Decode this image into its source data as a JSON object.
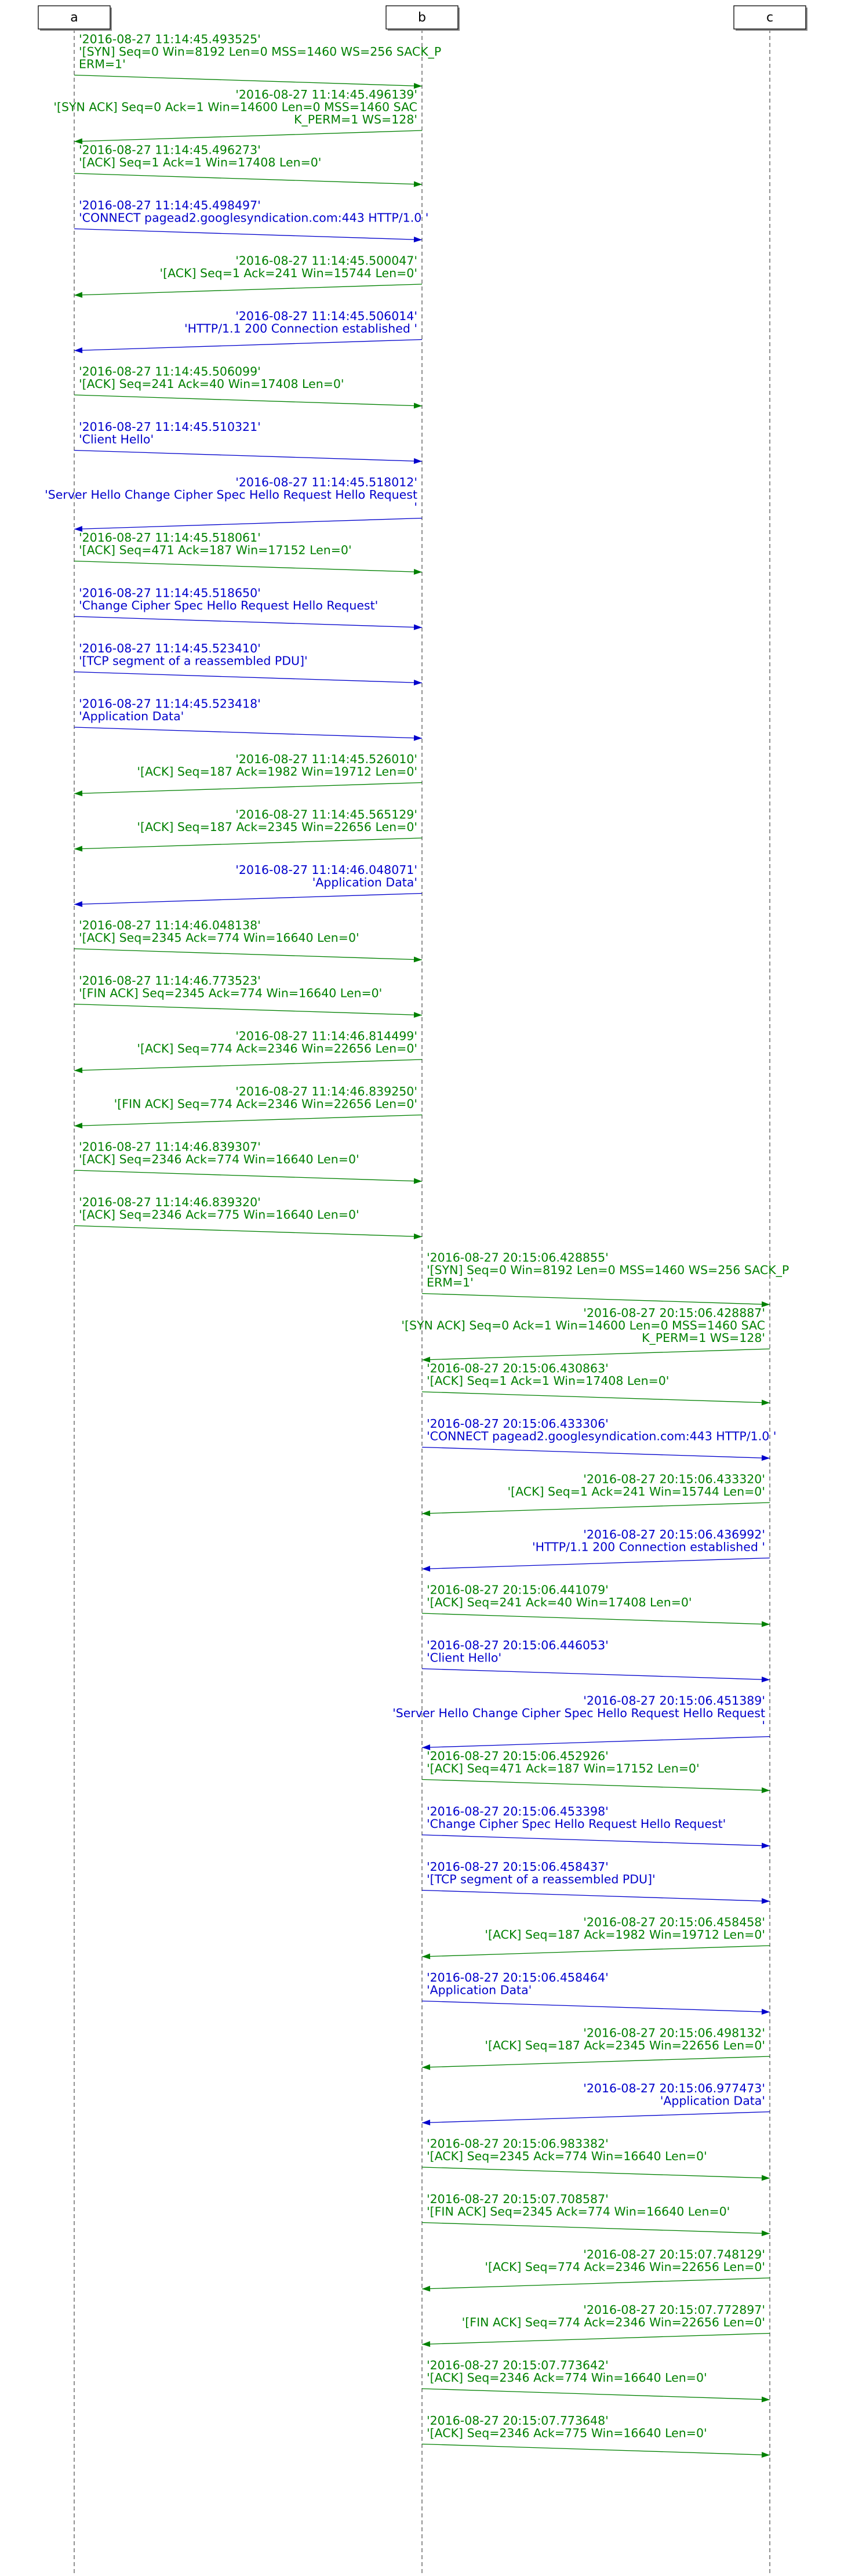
{
  "colors": {
    "green": "#008000",
    "blue": "#0000cc",
    "line": "#555555"
  },
  "participants": [
    {
      "id": "a",
      "label": "a"
    },
    {
      "id": "b",
      "label": "b"
    },
    {
      "id": "c",
      "label": "c"
    }
  ],
  "messages": [
    {
      "from": "a",
      "to": "b",
      "color": "green",
      "lines": [
        "'2016-08-27 11:14:45.493525'",
        "'[SYN] Seq=0 Win=8192 Len=0 MSS=1460 WS=256 SACK_P",
        "ERM=1'"
      ]
    },
    {
      "from": "b",
      "to": "a",
      "color": "green",
      "lines": [
        "'2016-08-27 11:14:45.496139'",
        "'[SYN ACK] Seq=0 Ack=1 Win=14600 Len=0 MSS=1460 SAC",
        "K_PERM=1 WS=128'"
      ]
    },
    {
      "from": "a",
      "to": "b",
      "color": "green",
      "lines": [
        "'2016-08-27 11:14:45.496273'",
        "'[ACK] Seq=1 Ack=1 Win=17408 Len=0'"
      ]
    },
    {
      "from": "a",
      "to": "b",
      "color": "blue",
      "lines": [
        "'2016-08-27 11:14:45.498497'",
        "'CONNECT pagead2.googlesyndication.com:443 HTTP/1.0 '"
      ]
    },
    {
      "from": "b",
      "to": "a",
      "color": "green",
      "lines": [
        "'2016-08-27 11:14:45.500047'",
        "'[ACK] Seq=1 Ack=241 Win=15744 Len=0'"
      ]
    },
    {
      "from": "b",
      "to": "a",
      "color": "blue",
      "lines": [
        "'2016-08-27 11:14:45.506014'",
        "'HTTP/1.1 200 Connection established '"
      ]
    },
    {
      "from": "a",
      "to": "b",
      "color": "green",
      "lines": [
        "'2016-08-27 11:14:45.506099'",
        "'[ACK] Seq=241 Ack=40 Win=17408 Len=0'"
      ]
    },
    {
      "from": "a",
      "to": "b",
      "color": "blue",
      "lines": [
        "'2016-08-27 11:14:45.510321'",
        "'Client Hello'"
      ]
    },
    {
      "from": "b",
      "to": "a",
      "color": "blue",
      "lines": [
        "'2016-08-27 11:14:45.518012'",
        "'Server Hello Change Cipher Spec Hello Request Hello Request",
        "'"
      ]
    },
    {
      "from": "a",
      "to": "b",
      "color": "green",
      "lines": [
        "'2016-08-27 11:14:45.518061'",
        "'[ACK] Seq=471 Ack=187 Win=17152 Len=0'"
      ]
    },
    {
      "from": "a",
      "to": "b",
      "color": "blue",
      "lines": [
        "'2016-08-27 11:14:45.518650'",
        "'Change Cipher Spec Hello Request Hello Request'"
      ]
    },
    {
      "from": "a",
      "to": "b",
      "color": "blue",
      "lines": [
        "'2016-08-27 11:14:45.523410'",
        "'[TCP segment of a reassembled PDU]'"
      ]
    },
    {
      "from": "a",
      "to": "b",
      "color": "blue",
      "lines": [
        "'2016-08-27 11:14:45.523418'",
        "'Application Data'"
      ]
    },
    {
      "from": "b",
      "to": "a",
      "color": "green",
      "lines": [
        "'2016-08-27 11:14:45.526010'",
        "'[ACK] Seq=187 Ack=1982 Win=19712 Len=0'"
      ]
    },
    {
      "from": "b",
      "to": "a",
      "color": "green",
      "lines": [
        "'2016-08-27 11:14:45.565129'",
        "'[ACK] Seq=187 Ack=2345 Win=22656 Len=0'"
      ]
    },
    {
      "from": "b",
      "to": "a",
      "color": "blue",
      "lines": [
        "'2016-08-27 11:14:46.048071'",
        "'Application Data'"
      ]
    },
    {
      "from": "a",
      "to": "b",
      "color": "green",
      "lines": [
        "'2016-08-27 11:14:46.048138'",
        "'[ACK] Seq=2345 Ack=774 Win=16640 Len=0'"
      ]
    },
    {
      "from": "a",
      "to": "b",
      "color": "green",
      "lines": [
        "'2016-08-27 11:14:46.773523'",
        "'[FIN ACK] Seq=2345 Ack=774 Win=16640 Len=0'"
      ]
    },
    {
      "from": "b",
      "to": "a",
      "color": "green",
      "lines": [
        "'2016-08-27 11:14:46.814499'",
        "'[ACK] Seq=774 Ack=2346 Win=22656 Len=0'"
      ]
    },
    {
      "from": "b",
      "to": "a",
      "color": "green",
      "lines": [
        "'2016-08-27 11:14:46.839250'",
        "'[FIN ACK] Seq=774 Ack=2346 Win=22656 Len=0'"
      ]
    },
    {
      "from": "a",
      "to": "b",
      "color": "green",
      "lines": [
        "'2016-08-27 11:14:46.839307'",
        "'[ACK] Seq=2346 Ack=774 Win=16640 Len=0'"
      ]
    },
    {
      "from": "a",
      "to": "b",
      "color": "green",
      "lines": [
        "'2016-08-27 11:14:46.839320'",
        "'[ACK] Seq=2346 Ack=775 Win=16640 Len=0'"
      ]
    },
    {
      "from": "b",
      "to": "c",
      "color": "green",
      "lines": [
        "'2016-08-27 20:15:06.428855'",
        "'[SYN] Seq=0 Win=8192 Len=0 MSS=1460 WS=256 SACK_P",
        "ERM=1'"
      ]
    },
    {
      "from": "c",
      "to": "b",
      "color": "green",
      "lines": [
        "'2016-08-27 20:15:06.428887'",
        "'[SYN ACK] Seq=0 Ack=1 Win=14600 Len=0 MSS=1460 SAC",
        "K_PERM=1 WS=128'"
      ]
    },
    {
      "from": "b",
      "to": "c",
      "color": "green",
      "lines": [
        "'2016-08-27 20:15:06.430863'",
        "'[ACK] Seq=1 Ack=1 Win=17408 Len=0'"
      ]
    },
    {
      "from": "b",
      "to": "c",
      "color": "blue",
      "lines": [
        "'2016-08-27 20:15:06.433306'",
        "'CONNECT pagead2.googlesyndication.com:443 HTTP/1.0 '"
      ]
    },
    {
      "from": "c",
      "to": "b",
      "color": "green",
      "lines": [
        "'2016-08-27 20:15:06.433320'",
        "'[ACK] Seq=1 Ack=241 Win=15744 Len=0'"
      ]
    },
    {
      "from": "c",
      "to": "b",
      "color": "blue",
      "lines": [
        "'2016-08-27 20:15:06.436992'",
        "'HTTP/1.1 200 Connection established '"
      ]
    },
    {
      "from": "b",
      "to": "c",
      "color": "green",
      "lines": [
        "'2016-08-27 20:15:06.441079'",
        "'[ACK] Seq=241 Ack=40 Win=17408 Len=0'"
      ]
    },
    {
      "from": "b",
      "to": "c",
      "color": "blue",
      "lines": [
        "'2016-08-27 20:15:06.446053'",
        "'Client Hello'"
      ]
    },
    {
      "from": "c",
      "to": "b",
      "color": "blue",
      "lines": [
        "'2016-08-27 20:15:06.451389'",
        "'Server Hello Change Cipher Spec Hello Request Hello Request",
        "'"
      ]
    },
    {
      "from": "b",
      "to": "c",
      "color": "green",
      "lines": [
        "'2016-08-27 20:15:06.452926'",
        "'[ACK] Seq=471 Ack=187 Win=17152 Len=0'"
      ]
    },
    {
      "from": "b",
      "to": "c",
      "color": "blue",
      "lines": [
        "'2016-08-27 20:15:06.453398'",
        "'Change Cipher Spec Hello Request Hello Request'"
      ]
    },
    {
      "from": "b",
      "to": "c",
      "color": "blue",
      "lines": [
        "'2016-08-27 20:15:06.458437'",
        "'[TCP segment of a reassembled PDU]'"
      ]
    },
    {
      "from": "c",
      "to": "b",
      "color": "green",
      "lines": [
        "'2016-08-27 20:15:06.458458'",
        "'[ACK] Seq=187 Ack=1982 Win=19712 Len=0'"
      ]
    },
    {
      "from": "b",
      "to": "c",
      "color": "blue",
      "lines": [
        "'2016-08-27 20:15:06.458464'",
        "'Application Data'"
      ]
    },
    {
      "from": "c",
      "to": "b",
      "color": "green",
      "lines": [
        "'2016-08-27 20:15:06.498132'",
        "'[ACK] Seq=187 Ack=2345 Win=22656 Len=0'"
      ]
    },
    {
      "from": "c",
      "to": "b",
      "color": "blue",
      "lines": [
        "'2016-08-27 20:15:06.977473'",
        "'Application Data'"
      ]
    },
    {
      "from": "b",
      "to": "c",
      "color": "green",
      "lines": [
        "'2016-08-27 20:15:06.983382'",
        "'[ACK] Seq=2345 Ack=774 Win=16640 Len=0'"
      ]
    },
    {
      "from": "b",
      "to": "c",
      "color": "green",
      "lines": [
        "'2016-08-27 20:15:07.708587'",
        "'[FIN ACK] Seq=2345 Ack=774 Win=16640 Len=0'"
      ]
    },
    {
      "from": "c",
      "to": "b",
      "color": "green",
      "lines": [
        "'2016-08-27 20:15:07.748129'",
        "'[ACK] Seq=774 Ack=2346 Win=22656 Len=0'"
      ]
    },
    {
      "from": "c",
      "to": "b",
      "color": "green",
      "lines": [
        "'2016-08-27 20:15:07.772897'",
        "'[FIN ACK] Seq=774 Ack=2346 Win=22656 Len=0'"
      ]
    },
    {
      "from": "b",
      "to": "c",
      "color": "green",
      "lines": [
        "'2016-08-27 20:15:07.773642'",
        "'[ACK] Seq=2346 Ack=774 Win=16640 Len=0'"
      ]
    },
    {
      "from": "b",
      "to": "c",
      "color": "green",
      "lines": [
        "'2016-08-27 20:15:07.773648'",
        "'[ACK] Seq=2346 Ack=775 Win=16640 Len=0'"
      ]
    }
  ]
}
